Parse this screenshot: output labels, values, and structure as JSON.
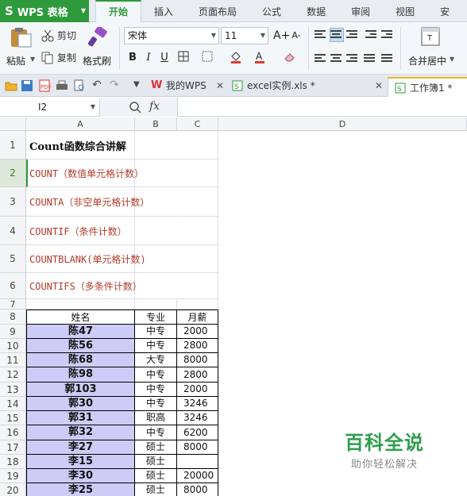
{
  "app": {
    "title": "WPS 表格",
    "logo": "S"
  },
  "menu_tabs": [
    {
      "label": "开始",
      "active": true
    },
    {
      "label": "插入"
    },
    {
      "label": "页面布局"
    },
    {
      "label": "公式"
    },
    {
      "label": "数据"
    },
    {
      "label": "审阅"
    },
    {
      "label": "视图"
    },
    {
      "label": "安"
    }
  ],
  "ribbon": {
    "paste": "粘贴",
    "cut": "剪切",
    "copy": "复制",
    "format_painter": "格式刷",
    "font_name": "宋体",
    "font_size": "11",
    "grow_font": "A+",
    "shrink_font": "A-",
    "bold": "B",
    "italic": "I",
    "underline": "U",
    "merge_center": "合并居中",
    "accent_color": "#2f9a3c",
    "fill_color": "#e03b2c",
    "font_color": "#e03b2c"
  },
  "doc_tabs": [
    {
      "label": "我的WPS"
    },
    {
      "label": "excel实例.xls *"
    },
    {
      "label": "工作簿1 *",
      "active": true
    }
  ],
  "formula_bar": {
    "cell_ref": "I2",
    "fx": "fx",
    "value": ""
  },
  "columns": [
    "A",
    "B",
    "C",
    "D"
  ],
  "rows": [
    "1",
    "2",
    "3",
    "4",
    "5",
    "6",
    "7",
    "8",
    "9",
    "10",
    "11",
    "12",
    "13",
    "14",
    "15",
    "16",
    "17",
    "18",
    "19",
    "20"
  ],
  "lines": [
    "Count函数综合讲解",
    "COUNT（数值单元格计数）",
    "COUNTA（非空单元格计数）",
    "COUNTIF（条件计数）",
    "COUNTBLANK(单元格计数)",
    "COUNTIFS（多条件计数）"
  ],
  "table": {
    "headers": [
      "姓名",
      "专业",
      "月薪"
    ],
    "rows": [
      [
        "陈47",
        "中专",
        "2000"
      ],
      [
        "陈56",
        "中专",
        "2800"
      ],
      [
        "陈68",
        "大专",
        "8000"
      ],
      [
        "陈98",
        "中专",
        "2800"
      ],
      [
        "郭103",
        "中专",
        "2000"
      ],
      [
        "郭30",
        "中专",
        "3246"
      ],
      [
        "郭31",
        "职高",
        "3246"
      ],
      [
        "郭32",
        "中专",
        "6200"
      ],
      [
        "李27",
        "硕士",
        "8000"
      ],
      [
        "李15",
        "硕士",
        ""
      ],
      [
        "李30",
        "硕士",
        "20000"
      ],
      [
        "李25",
        "硕士",
        "8000"
      ]
    ]
  },
  "watermark": {
    "title": "百科全说",
    "subtitle": "助你轻松解决"
  }
}
